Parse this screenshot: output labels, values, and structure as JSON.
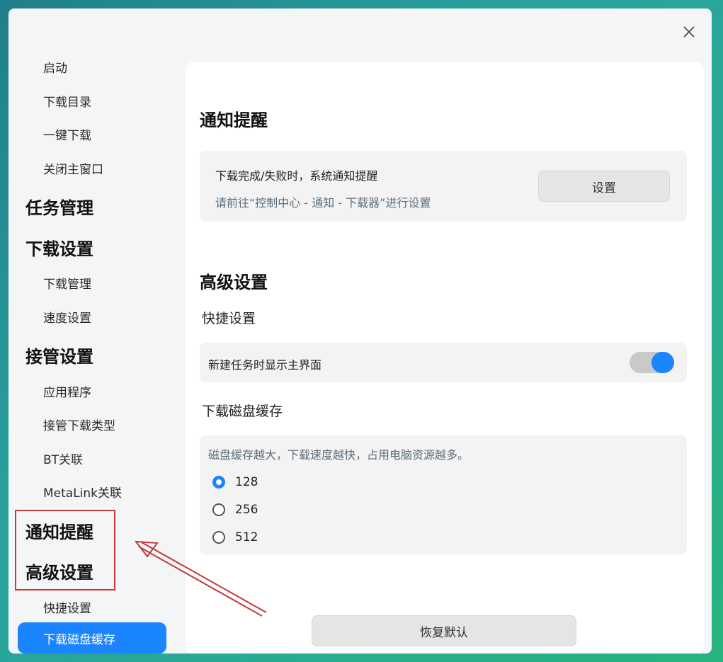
{
  "window": {
    "close_icon": "close-icon"
  },
  "sidebar": {
    "items": [
      {
        "type": "item",
        "label": "启动"
      },
      {
        "type": "item",
        "label": "下载目录"
      },
      {
        "type": "item",
        "label": "一键下载"
      },
      {
        "type": "item",
        "label": "关闭主窗口"
      },
      {
        "type": "group",
        "label": "任务管理"
      },
      {
        "type": "group",
        "label": "下载设置"
      },
      {
        "type": "item",
        "label": "下载管理"
      },
      {
        "type": "item",
        "label": "速度设置"
      },
      {
        "type": "group",
        "label": "接管设置"
      },
      {
        "type": "item",
        "label": "应用程序"
      },
      {
        "type": "item",
        "label": "接管下载类型"
      },
      {
        "type": "item",
        "label": "BT关联"
      },
      {
        "type": "item",
        "label": "MetaLink关联"
      },
      {
        "type": "group",
        "label": "通知提醒"
      },
      {
        "type": "group",
        "label": "高级设置"
      },
      {
        "type": "item",
        "label": "快捷设置"
      },
      {
        "type": "active",
        "label": "下载磁盘缓存"
      }
    ]
  },
  "notification": {
    "title": "通知提醒",
    "description": "下载完成/失败时，系统通知提醒",
    "hint": "请前往“控制中心 - 通知 - 下载器”进行设置",
    "button_label": "设置"
  },
  "advanced": {
    "title": "高级设置",
    "shortcut_title": "快捷设置",
    "show_main_label": "新建任务时显示主界面",
    "show_main_enabled": true,
    "cache_title": "下载磁盘缓存",
    "cache_hint": "磁盘缓存越大，下载速度越快，占用电脑资源越多。",
    "cache_options": [
      "128",
      "256",
      "512"
    ],
    "cache_selected": "128"
  },
  "footer": {
    "restore_label": "恢复默认"
  },
  "colors": {
    "accent": "#1a85ff",
    "annotation": "#c23a3a"
  }
}
